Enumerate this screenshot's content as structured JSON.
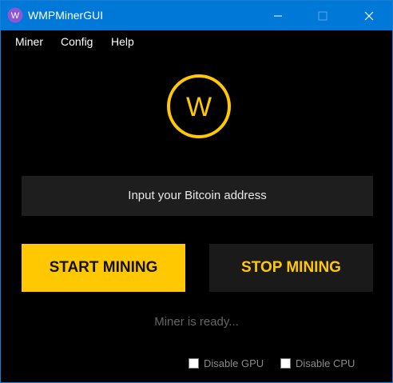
{
  "window": {
    "title": "WMPMinerGUI",
    "app_icon": "wmp-logo-icon",
    "controls": [
      "minimize-icon",
      "maximize-icon",
      "close-icon"
    ]
  },
  "menu": {
    "items": [
      {
        "label": "Miner"
      },
      {
        "label": "Config"
      },
      {
        "label": "Help"
      }
    ]
  },
  "main": {
    "logo_letter": "W",
    "address_placeholder": "Input your Bitcoin address",
    "start_label": "START MINING",
    "stop_label": "STOP MINING",
    "status_text": "Miner is ready...",
    "checkboxes": [
      {
        "label": "Disable GPU",
        "checked": false
      },
      {
        "label": "Disable CPU",
        "checked": false
      }
    ]
  },
  "colors": {
    "titlebar": "#0078d7",
    "accent": "#ffc800",
    "background": "#000000",
    "field": "#1e1e1e"
  }
}
